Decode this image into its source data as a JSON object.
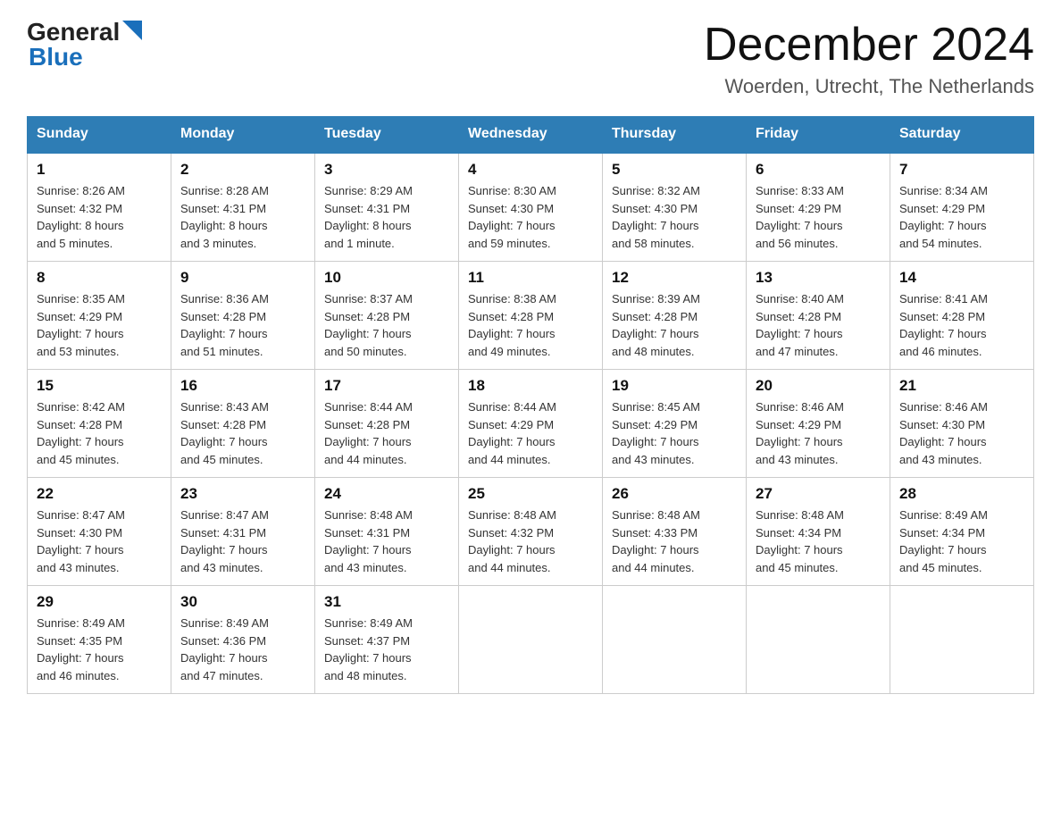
{
  "header": {
    "month_title": "December 2024",
    "location": "Woerden, Utrecht, The Netherlands",
    "logo_general": "General",
    "logo_blue": "Blue"
  },
  "days_of_week": [
    "Sunday",
    "Monday",
    "Tuesday",
    "Wednesday",
    "Thursday",
    "Friday",
    "Saturday"
  ],
  "weeks": [
    [
      {
        "day": "1",
        "info": "Sunrise: 8:26 AM\nSunset: 4:32 PM\nDaylight: 8 hours\nand 5 minutes."
      },
      {
        "day": "2",
        "info": "Sunrise: 8:28 AM\nSunset: 4:31 PM\nDaylight: 8 hours\nand 3 minutes."
      },
      {
        "day": "3",
        "info": "Sunrise: 8:29 AM\nSunset: 4:31 PM\nDaylight: 8 hours\nand 1 minute."
      },
      {
        "day": "4",
        "info": "Sunrise: 8:30 AM\nSunset: 4:30 PM\nDaylight: 7 hours\nand 59 minutes."
      },
      {
        "day": "5",
        "info": "Sunrise: 8:32 AM\nSunset: 4:30 PM\nDaylight: 7 hours\nand 58 minutes."
      },
      {
        "day": "6",
        "info": "Sunrise: 8:33 AM\nSunset: 4:29 PM\nDaylight: 7 hours\nand 56 minutes."
      },
      {
        "day": "7",
        "info": "Sunrise: 8:34 AM\nSunset: 4:29 PM\nDaylight: 7 hours\nand 54 minutes."
      }
    ],
    [
      {
        "day": "8",
        "info": "Sunrise: 8:35 AM\nSunset: 4:29 PM\nDaylight: 7 hours\nand 53 minutes."
      },
      {
        "day": "9",
        "info": "Sunrise: 8:36 AM\nSunset: 4:28 PM\nDaylight: 7 hours\nand 51 minutes."
      },
      {
        "day": "10",
        "info": "Sunrise: 8:37 AM\nSunset: 4:28 PM\nDaylight: 7 hours\nand 50 minutes."
      },
      {
        "day": "11",
        "info": "Sunrise: 8:38 AM\nSunset: 4:28 PM\nDaylight: 7 hours\nand 49 minutes."
      },
      {
        "day": "12",
        "info": "Sunrise: 8:39 AM\nSunset: 4:28 PM\nDaylight: 7 hours\nand 48 minutes."
      },
      {
        "day": "13",
        "info": "Sunrise: 8:40 AM\nSunset: 4:28 PM\nDaylight: 7 hours\nand 47 minutes."
      },
      {
        "day": "14",
        "info": "Sunrise: 8:41 AM\nSunset: 4:28 PM\nDaylight: 7 hours\nand 46 minutes."
      }
    ],
    [
      {
        "day": "15",
        "info": "Sunrise: 8:42 AM\nSunset: 4:28 PM\nDaylight: 7 hours\nand 45 minutes."
      },
      {
        "day": "16",
        "info": "Sunrise: 8:43 AM\nSunset: 4:28 PM\nDaylight: 7 hours\nand 45 minutes."
      },
      {
        "day": "17",
        "info": "Sunrise: 8:44 AM\nSunset: 4:28 PM\nDaylight: 7 hours\nand 44 minutes."
      },
      {
        "day": "18",
        "info": "Sunrise: 8:44 AM\nSunset: 4:29 PM\nDaylight: 7 hours\nand 44 minutes."
      },
      {
        "day": "19",
        "info": "Sunrise: 8:45 AM\nSunset: 4:29 PM\nDaylight: 7 hours\nand 43 minutes."
      },
      {
        "day": "20",
        "info": "Sunrise: 8:46 AM\nSunset: 4:29 PM\nDaylight: 7 hours\nand 43 minutes."
      },
      {
        "day": "21",
        "info": "Sunrise: 8:46 AM\nSunset: 4:30 PM\nDaylight: 7 hours\nand 43 minutes."
      }
    ],
    [
      {
        "day": "22",
        "info": "Sunrise: 8:47 AM\nSunset: 4:30 PM\nDaylight: 7 hours\nand 43 minutes."
      },
      {
        "day": "23",
        "info": "Sunrise: 8:47 AM\nSunset: 4:31 PM\nDaylight: 7 hours\nand 43 minutes."
      },
      {
        "day": "24",
        "info": "Sunrise: 8:48 AM\nSunset: 4:31 PM\nDaylight: 7 hours\nand 43 minutes."
      },
      {
        "day": "25",
        "info": "Sunrise: 8:48 AM\nSunset: 4:32 PM\nDaylight: 7 hours\nand 44 minutes."
      },
      {
        "day": "26",
        "info": "Sunrise: 8:48 AM\nSunset: 4:33 PM\nDaylight: 7 hours\nand 44 minutes."
      },
      {
        "day": "27",
        "info": "Sunrise: 8:48 AM\nSunset: 4:34 PM\nDaylight: 7 hours\nand 45 minutes."
      },
      {
        "day": "28",
        "info": "Sunrise: 8:49 AM\nSunset: 4:34 PM\nDaylight: 7 hours\nand 45 minutes."
      }
    ],
    [
      {
        "day": "29",
        "info": "Sunrise: 8:49 AM\nSunset: 4:35 PM\nDaylight: 7 hours\nand 46 minutes."
      },
      {
        "day": "30",
        "info": "Sunrise: 8:49 AM\nSunset: 4:36 PM\nDaylight: 7 hours\nand 47 minutes."
      },
      {
        "day": "31",
        "info": "Sunrise: 8:49 AM\nSunset: 4:37 PM\nDaylight: 7 hours\nand 48 minutes."
      },
      {
        "day": "",
        "info": ""
      },
      {
        "day": "",
        "info": ""
      },
      {
        "day": "",
        "info": ""
      },
      {
        "day": "",
        "info": ""
      }
    ]
  ]
}
